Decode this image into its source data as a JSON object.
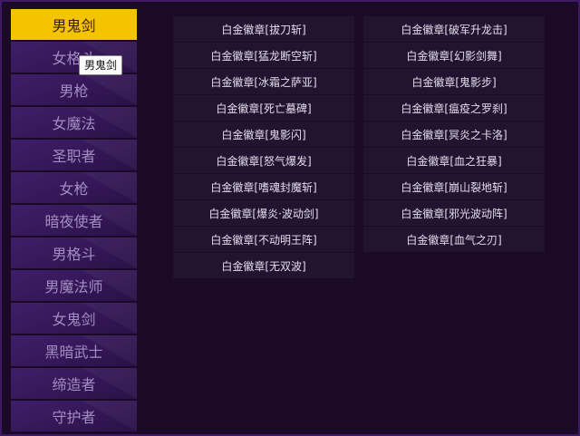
{
  "sidebar": {
    "items": [
      {
        "label": "男鬼剑",
        "active": true
      },
      {
        "label": "女格斗",
        "active": false
      },
      {
        "label": "男枪",
        "active": false
      },
      {
        "label": "女魔法",
        "active": false
      },
      {
        "label": "圣职者",
        "active": false
      },
      {
        "label": "女枪",
        "active": false
      },
      {
        "label": "暗夜使者",
        "active": false
      },
      {
        "label": "男格斗",
        "active": false
      },
      {
        "label": "男魔法师",
        "active": false
      },
      {
        "label": "女鬼剑",
        "active": false
      },
      {
        "label": "黑暗武士",
        "active": false
      },
      {
        "label": "缔造者",
        "active": false
      },
      {
        "label": "守护者",
        "active": false
      }
    ]
  },
  "tooltip": {
    "text": "男鬼剑"
  },
  "emblems": {
    "left": [
      "白金徽章[拔刀斩]",
      "白金徽章[猛龙断空斩]",
      "白金徽章[冰霜之萨亚]",
      "白金徽章[死亡墓碑]",
      "白金徽章[鬼影闪]",
      "白金徽章[怒气爆发]",
      "白金徽章[嗜魂封魔斩]",
      "白金徽章[爆炎·波动剑]",
      "白金徽章[不动明王阵]",
      "白金徽章[无双波]"
    ],
    "right": [
      "白金徽章[破军升龙击]",
      "白金徽章[幻影剑舞]",
      "白金徽章[鬼影步]",
      "白金徽章[瘟疫之罗刹]",
      "白金徽章[冥炎之卡洛]",
      "白金徽章[血之狂暴]",
      "白金徽章[崩山裂地斩]",
      "白金徽章[邪光波动阵]",
      "白金徽章[血气之刃]"
    ]
  },
  "colors": {
    "active_tab": "#f5c400",
    "background": "#1a0a28",
    "cell": "#221430"
  }
}
